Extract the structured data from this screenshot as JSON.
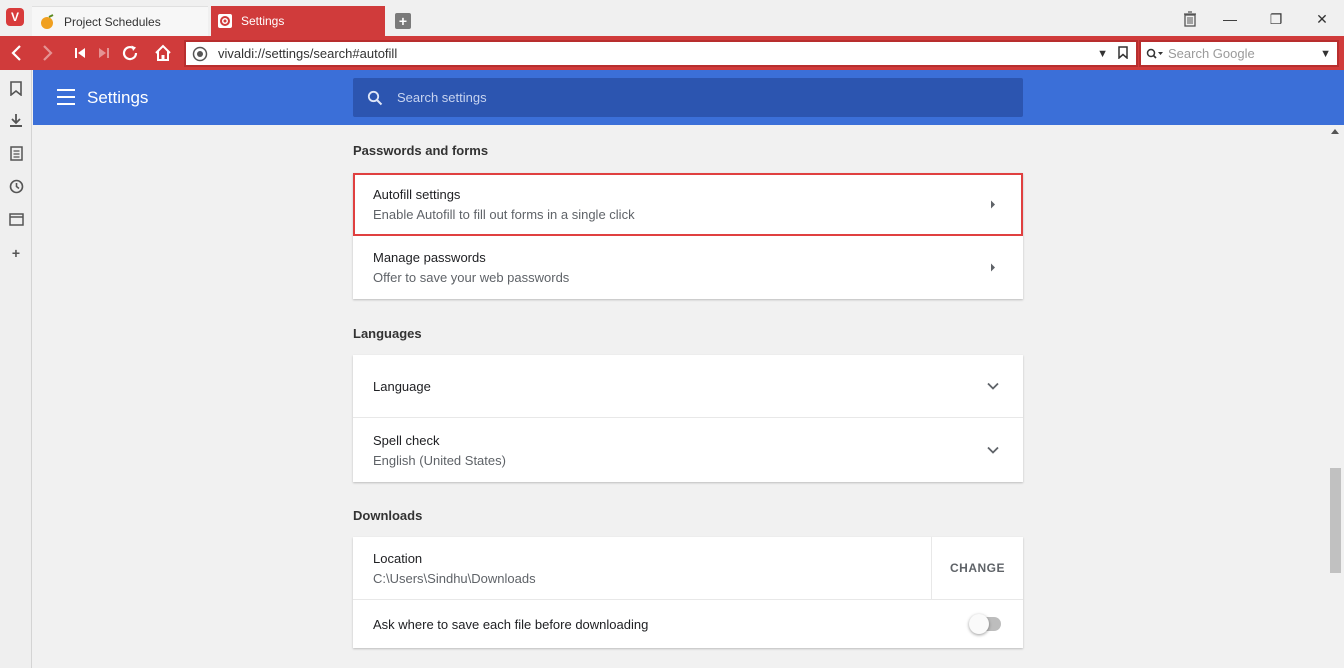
{
  "browser": {
    "tabs": [
      {
        "label": "Project Schedules",
        "active": false,
        "icon": "fruit-icon"
      },
      {
        "label": "Settings",
        "active": true,
        "icon": "gear-icon"
      }
    ],
    "logo": "V",
    "new_tab": "+",
    "window_controls": {
      "minimize": "—",
      "restore": "❐",
      "close": "✕"
    },
    "address": {
      "url": "vivaldi://settings/search#autofill"
    },
    "search": {
      "placeholder": "Search Google"
    },
    "accent_color": "#d03b3b"
  },
  "sidepanel": {
    "items": [
      "bookmark-icon",
      "download-icon",
      "notes-icon",
      "history-icon",
      "window-icon",
      "add-panel-icon"
    ]
  },
  "settings": {
    "title": "Settings",
    "search_placeholder": "Search settings",
    "header_color": "#3b6fd8",
    "sections": {
      "passwords": {
        "label": "Passwords and forms",
        "rows": [
          {
            "title": "Autofill settings",
            "sub": "Enable Autofill to fill out forms in a single click"
          },
          {
            "title": "Manage passwords",
            "sub": "Offer to save your web passwords"
          }
        ]
      },
      "languages": {
        "label": "Languages",
        "rows": [
          {
            "title": "Language"
          },
          {
            "title": "Spell check",
            "sub": "English (United States)"
          }
        ]
      },
      "downloads": {
        "label": "Downloads",
        "location": {
          "title": "Location",
          "sub": "C:\\Users\\Sindhu\\Downloads",
          "button": "CHANGE"
        },
        "ask": {
          "title": "Ask where to save each file before downloading",
          "enabled": false
        }
      }
    }
  }
}
